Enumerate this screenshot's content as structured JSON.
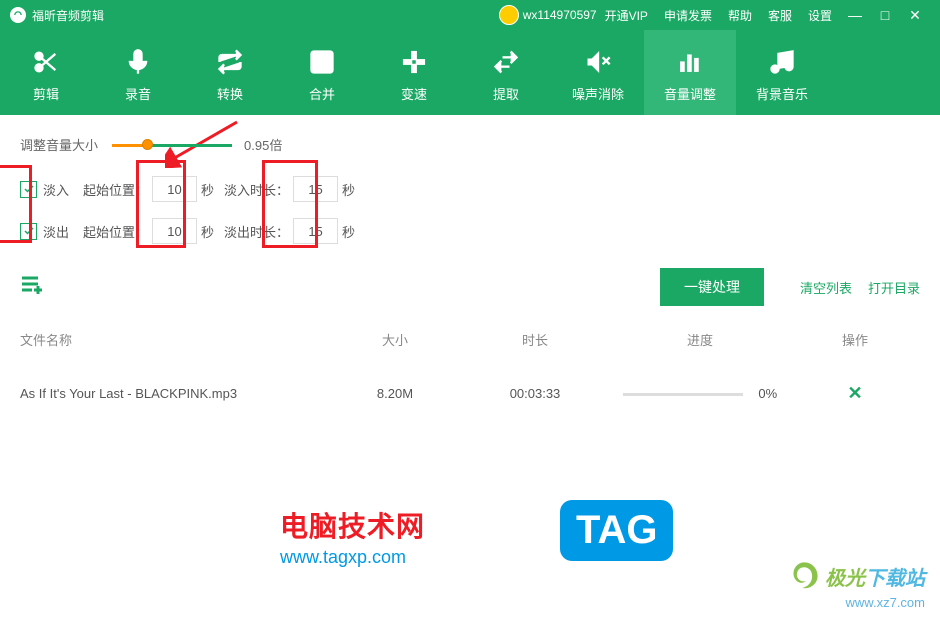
{
  "titlebar": {
    "app_name": "福昕音频剪辑",
    "username": "wx114970597",
    "vip": "开通VIP",
    "invoice": "申请发票",
    "help": "帮助",
    "service": "客服",
    "settings": "设置"
  },
  "toolbar": {
    "items": [
      {
        "label": "剪辑",
        "icon": "scissors"
      },
      {
        "label": "录音",
        "icon": "mic"
      },
      {
        "label": "转换",
        "icon": "convert"
      },
      {
        "label": "合并",
        "icon": "merge"
      },
      {
        "label": "变速",
        "icon": "speed"
      },
      {
        "label": "提取",
        "icon": "extract"
      },
      {
        "label": "噪声消除",
        "icon": "denoise"
      },
      {
        "label": "音量调整",
        "icon": "volume",
        "active": true
      },
      {
        "label": "背景音乐",
        "icon": "bgmusic"
      }
    ]
  },
  "settings": {
    "volume_label": "调整音量大小",
    "volume_value": "0.95倍",
    "fade_in": {
      "checked": true,
      "label": "淡入",
      "start_label": "起始位置：",
      "start_value": "10",
      "start_unit": "秒",
      "len_label": "淡入时长：",
      "len_value": "15",
      "len_unit": "秒"
    },
    "fade_out": {
      "checked": true,
      "label": "淡出",
      "start_label": "起始位置：",
      "start_value": "10",
      "start_unit": "秒",
      "len_label": "淡出时长：",
      "len_value": "15",
      "len_unit": "秒"
    }
  },
  "buttons": {
    "process": "一键处理",
    "clear_list": "清空列表",
    "open_dir": "打开目录"
  },
  "table": {
    "headers": {
      "name": "文件名称",
      "size": "大小",
      "duration": "时长",
      "progress": "进度",
      "operation": "操作"
    },
    "rows": [
      {
        "name": "As If It's Your Last - BLACKPINK.mp3",
        "size": "8.20M",
        "duration": "00:03:33",
        "progress": "0%"
      }
    ]
  },
  "watermarks": {
    "site1_name": "电脑技术网",
    "site1_url": "www.tagxp.com",
    "tag": "TAG",
    "site2_name_part1": "极光",
    "site2_name_part2": "下载站",
    "site2_url": "www.xz7.com"
  }
}
